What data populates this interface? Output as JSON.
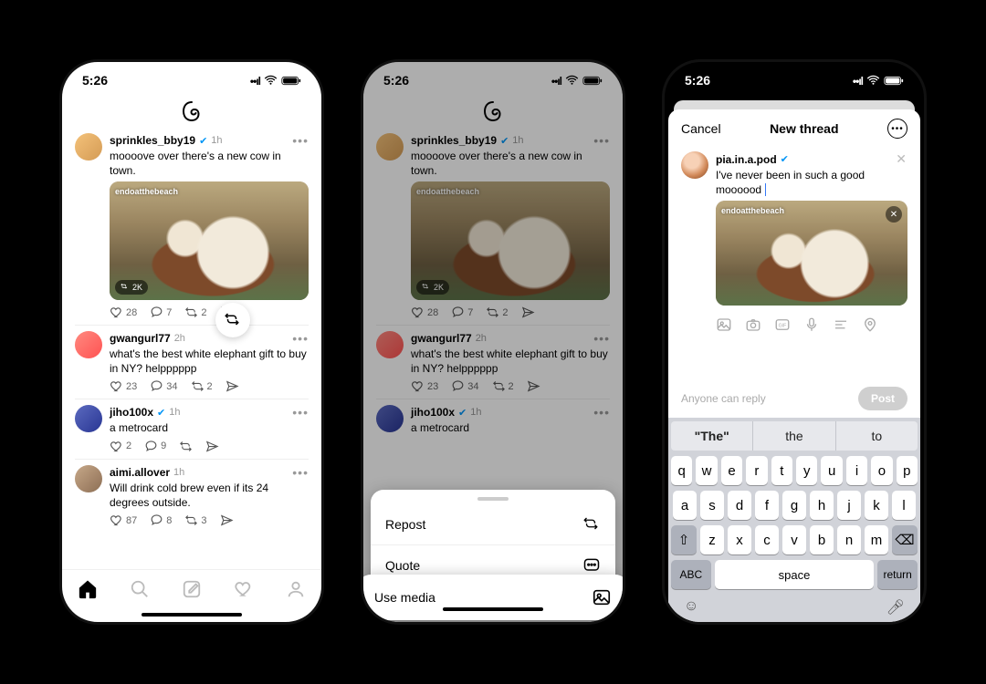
{
  "status": {
    "time": "5:26"
  },
  "posts": [
    {
      "user": "sprinkles_bby19",
      "verified": true,
      "time": "1h",
      "text": "moooove over there's a new cow in town.",
      "likes": "28",
      "replies": "7",
      "reposts": "2",
      "media_tag": "endoatthebeach",
      "media_badge": "2K"
    },
    {
      "user": "gwangurl77",
      "verified": false,
      "time": "2h",
      "text": "what's the best white elephant gift to buy in NY? helpppppp",
      "likes": "23",
      "replies": "34",
      "reposts": "2"
    },
    {
      "user": "jiho100x",
      "verified": true,
      "time": "1h",
      "text": "a metrocard",
      "likes": "2",
      "replies": "9",
      "reposts": ""
    },
    {
      "user": "aimi.allover",
      "verified": false,
      "time": "1h",
      "text": "Will drink cold brew even if its 24 degrees outside.",
      "likes": "87",
      "replies": "8",
      "reposts": "3"
    }
  ],
  "sheet": {
    "repost": "Repost",
    "quote": "Quote",
    "use_media": "Use media"
  },
  "composer": {
    "cancel": "Cancel",
    "title": "New thread",
    "user": "pia.in.a.pod",
    "text": "I've never been in such a good moooood",
    "media_tag": "endoatthebeach",
    "reply_scope": "Anyone can reply",
    "post": "Post"
  },
  "keyboard": {
    "suggestions": [
      "\"The\"",
      "the",
      "to"
    ],
    "row1": [
      "q",
      "w",
      "e",
      "r",
      "t",
      "y",
      "u",
      "i",
      "o",
      "p"
    ],
    "row2": [
      "a",
      "s",
      "d",
      "f",
      "g",
      "h",
      "j",
      "k",
      "l"
    ],
    "row3": [
      "z",
      "x",
      "c",
      "v",
      "b",
      "n",
      "m"
    ],
    "abc": "ABC",
    "space": "space",
    "return": "return"
  }
}
